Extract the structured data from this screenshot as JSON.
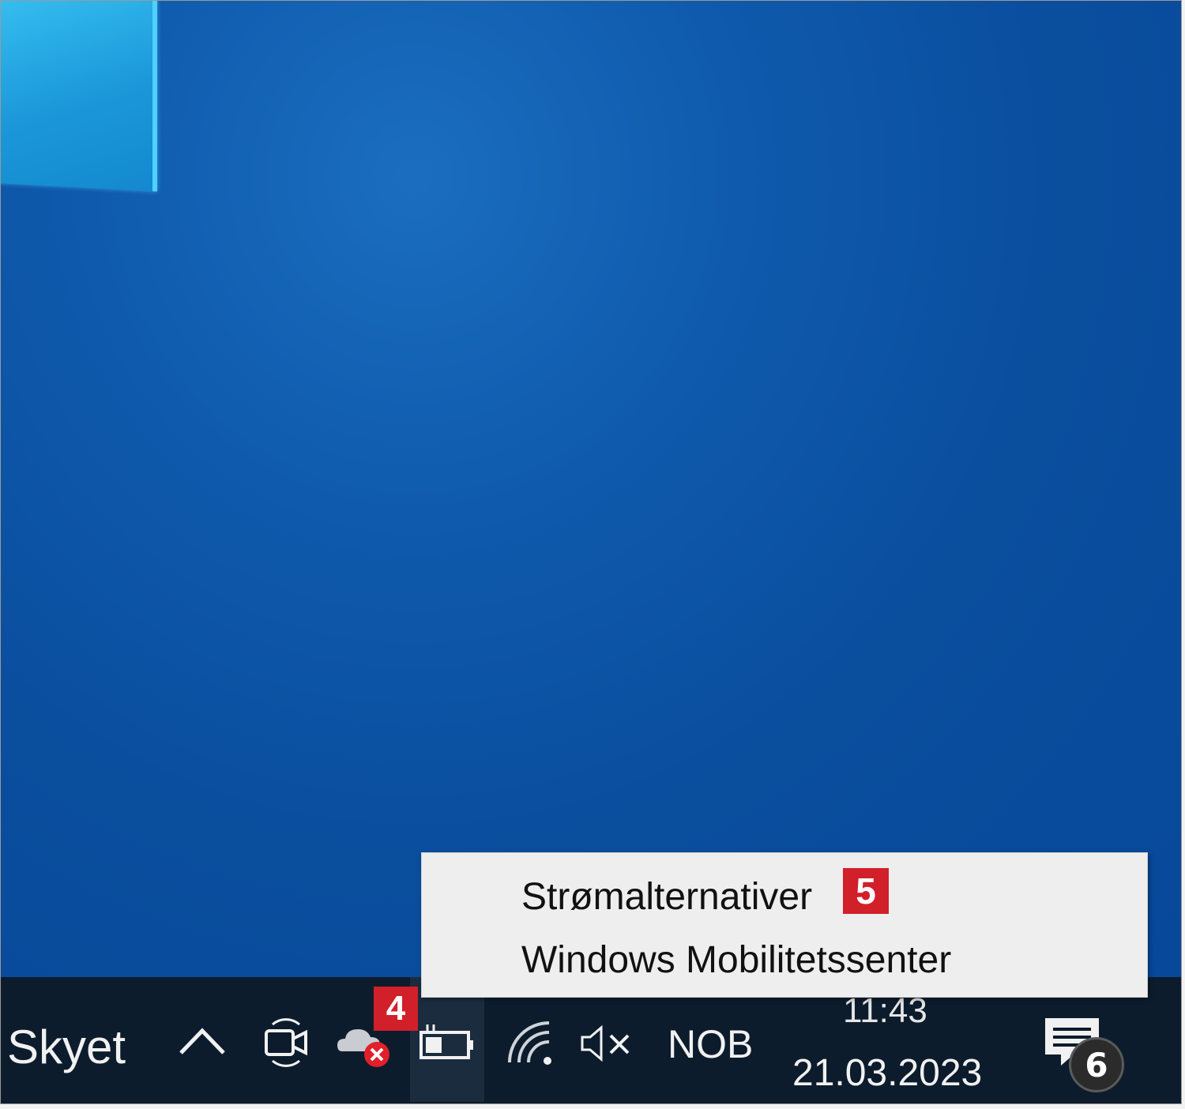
{
  "desktop": {},
  "taskbar": {
    "weather_label": "Skyet",
    "language": "NOB",
    "clock": {
      "time": "11:43",
      "date": "21.03.2023"
    },
    "notification_count": "6",
    "tray_icons": [
      "chevron-up-icon",
      "meet-now-icon",
      "onedrive-error-icon",
      "battery-charging-icon",
      "wifi-icon",
      "volume-muted-icon"
    ]
  },
  "context_menu": {
    "items": [
      {
        "label": "Strømalternativer"
      },
      {
        "label": "Windows Mobilitetssenter"
      }
    ]
  },
  "annotations": {
    "badge_a": "4",
    "badge_b": "5"
  },
  "colors": {
    "badge_red": "#d1202a",
    "taskbar": "#0d1c2c",
    "desktop_blue": "#0a4e9e",
    "menu_bg": "#eeeeee"
  }
}
